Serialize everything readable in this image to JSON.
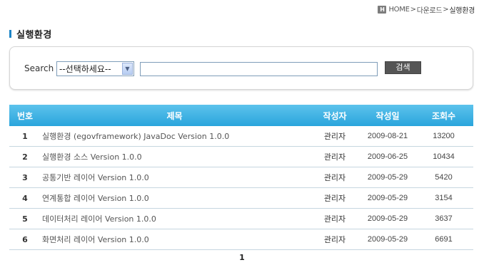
{
  "breadcrumb": {
    "home_icon": "H",
    "home": "HOME",
    "sep1": ">",
    "item1": "다운로드",
    "sep2": ">",
    "current": "실행환경"
  },
  "page": {
    "title": "실행환경"
  },
  "search": {
    "label": "Search",
    "select_value": "--선택하세요--",
    "input_value": "",
    "button_label": "검색"
  },
  "board": {
    "headers": {
      "no": "번호",
      "title": "제목",
      "author": "작성자",
      "date": "작성일",
      "views": "조회수"
    },
    "rows": [
      {
        "no": "1",
        "title": "실행환경 (egovframework) JavaDoc Version 1.0.0",
        "author": "관리자",
        "date": "2009-08-21",
        "views": "13200"
      },
      {
        "no": "2",
        "title": "실행환경 소스 Version 1.0.0",
        "author": "관리자",
        "date": "2009-06-25",
        "views": "10434"
      },
      {
        "no": "3",
        "title": "공통기반 레이어 Version 1.0.0",
        "author": "관리자",
        "date": "2009-05-29",
        "views": "5420"
      },
      {
        "no": "4",
        "title": "연계통합 레이어 Version 1.0.0",
        "author": "관리자",
        "date": "2009-05-29",
        "views": "3154"
      },
      {
        "no": "5",
        "title": "데이터처리 레이어 Version 1.0.0",
        "author": "관리자",
        "date": "2009-05-29",
        "views": "3637"
      },
      {
        "no": "6",
        "title": "화면처리 레이어 Version 1.0.0",
        "author": "관리자",
        "date": "2009-05-29",
        "views": "6691"
      }
    ]
  },
  "pagination": {
    "current_page": "1"
  },
  "colors": {
    "accent": "#1c84c6",
    "header_bg": "#35aee2",
    "button_bg": "#555555"
  }
}
